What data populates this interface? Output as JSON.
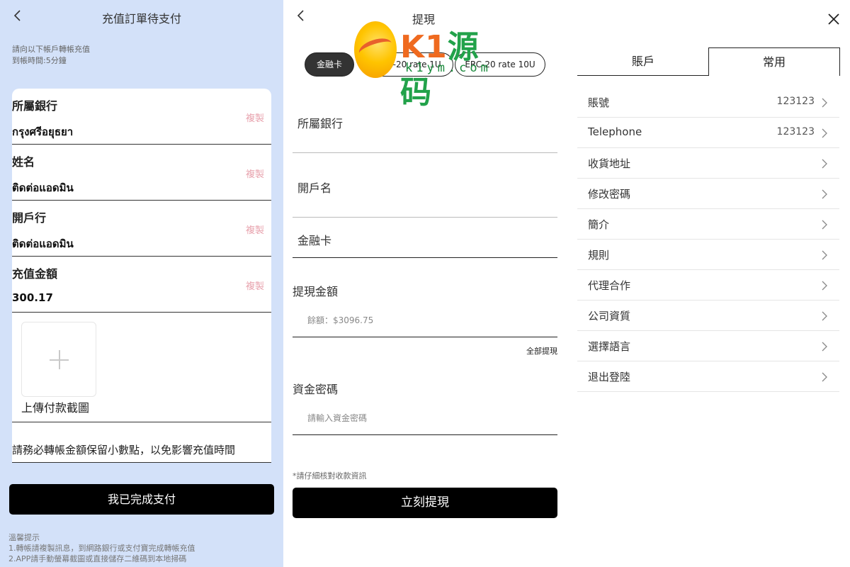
{
  "deposit": {
    "title": "充值訂單待支付",
    "notice_line1": "請向以下帳戶轉帳充值",
    "notice_line2": "到帳時間:5分鐘",
    "rows": [
      {
        "label": "所屬銀行",
        "value": "กรุงศรีอยุธยา",
        "copy": "複製"
      },
      {
        "label": "姓名",
        "value": "ติดต่อแอดมิน",
        "copy": "複製"
      },
      {
        "label": "開戶行",
        "value": "ติดต่อแอดมิน",
        "copy": "複製"
      },
      {
        "label": "充值金額",
        "value": "300.17",
        "copy": "複製"
      }
    ],
    "upload_label": "上傳付款截圖",
    "warning": "請務必轉帳金額保留小數點，以免影響充值時間",
    "submit_label": "我已完成支付",
    "tips_title": "溫馨提示",
    "tips_1": "1.轉帳請複製訊息，到網路銀行或支付寶完成轉帳充值",
    "tips_2": "2.APP請手動螢幕截圖或直接儲存二維碼到本地掃碼"
  },
  "withdraw": {
    "title": "提現",
    "methods": [
      "金融卡",
      "C-20 rate 1U",
      "ERC-20 rate 10U"
    ],
    "active_method": "金融卡",
    "watermark_main": "K1源码",
    "watermark_sub": "k1ym.com",
    "field_bank": "所屬銀行",
    "field_name": "開戶名",
    "field_card": "金融卡",
    "amount_label": "提現金額",
    "balance_placeholder": "餘額：$3096.75",
    "withdraw_all": "全部提現",
    "password_label": "資金密碼",
    "password_placeholder": "請輸入資金密碼",
    "verify_note": "*請仔細核對收款資訊",
    "submit_label": "立刻提現"
  },
  "profile": {
    "tabs": [
      "賬戶",
      "常用"
    ],
    "active_tab": "常用",
    "menu": [
      {
        "label": "賬號",
        "value": "123123"
      },
      {
        "label": "Telephone",
        "value": "123123"
      },
      {
        "label": "收貨地址",
        "value": ""
      },
      {
        "label": "修改密碼",
        "value": ""
      },
      {
        "label": "簡介",
        "value": ""
      },
      {
        "label": "規則",
        "value": ""
      },
      {
        "label": "代理合作",
        "value": ""
      },
      {
        "label": "公司資質",
        "value": ""
      },
      {
        "label": "選擇語言",
        "value": ""
      },
      {
        "label": "退出登陸",
        "value": ""
      }
    ]
  },
  "colors": {
    "deposit_bg": "#d3e1f9",
    "copy_text": "#e8a3ae",
    "primary_button": "#000000"
  }
}
